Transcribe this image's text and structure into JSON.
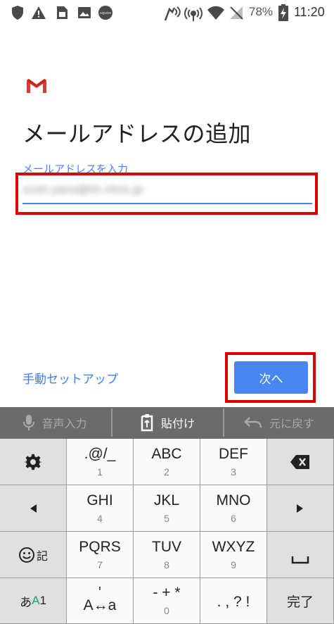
{
  "status_bar": {
    "battery": "78%",
    "time": "11:20"
  },
  "page": {
    "title": "メールアドレスの追加",
    "field_label": "メールアドレスを入力",
    "email_value": "xxxh.yano@hh.nhns.jp",
    "manual_setup": "手動セットアップ",
    "next_button": "次へ"
  },
  "keyboard": {
    "toolbar": {
      "voice": "音声入力",
      "paste": "貼付け",
      "undo": "元に戻す"
    },
    "keys": {
      "k1_main": ".@/_",
      "k1_sub": "1",
      "k2_main": "ABC",
      "k2_sub": "2",
      "k3_main": "DEF",
      "k3_sub": "3",
      "k4_main": "GHI",
      "k4_sub": "4",
      "k5_main": "JKL",
      "k5_sub": "5",
      "k6_main": "MNO",
      "k6_sub": "6",
      "k7_main": "PQRS",
      "k7_sub": "7",
      "k8_main": "TUV",
      "k8_sub": "8",
      "k9_main": "WXYZ",
      "k9_sub": "9",
      "kcase_top": "'",
      "kcase_main": "A↔a",
      "k0_main": "- + *",
      "k0_sub": "0",
      "kpunct_main": ". , ? !",
      "kemoji_label": "記",
      "kmode_a": "あ",
      "kmode_b": "A",
      "kmode_c": "1",
      "kdone": "完了"
    }
  }
}
